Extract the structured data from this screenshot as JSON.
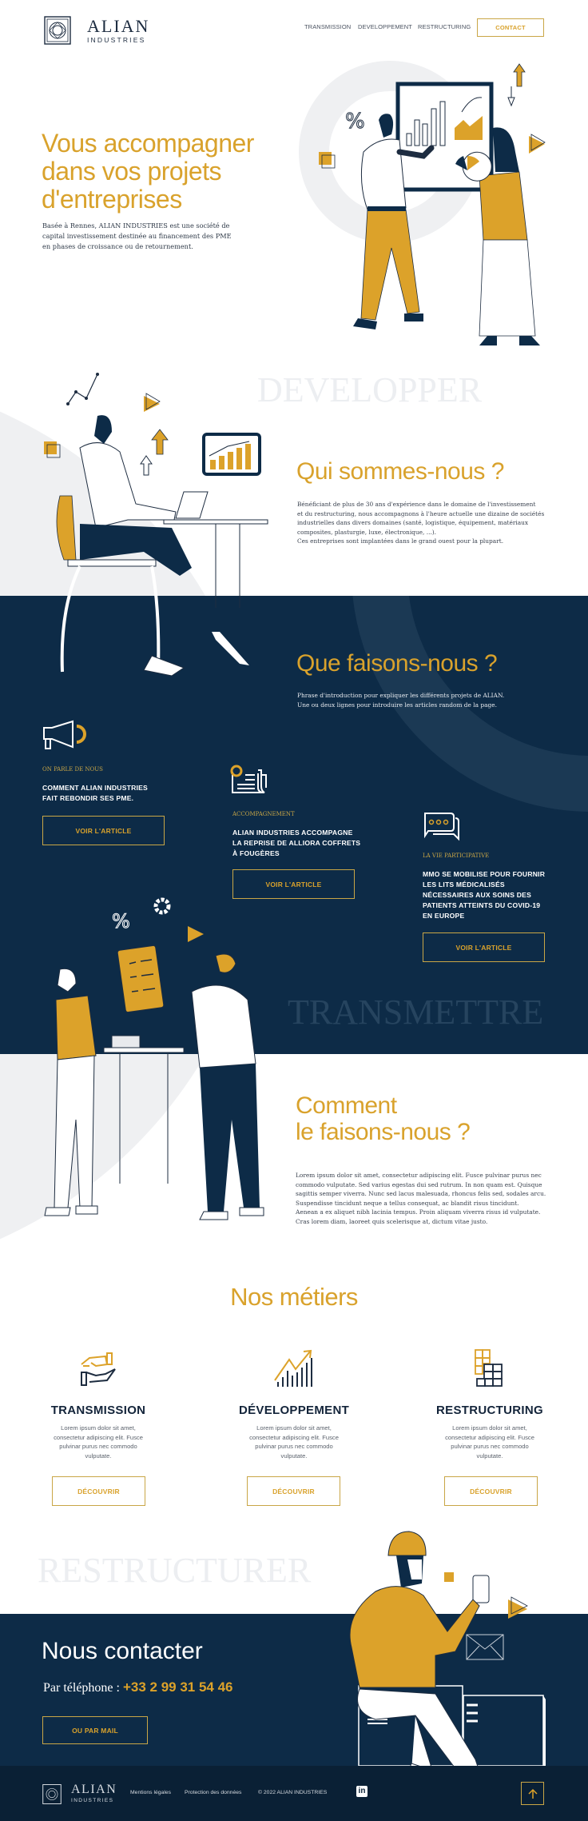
{
  "header": {
    "logo": {
      "name": "ALIAN",
      "sub": "INDUSTRIES"
    },
    "nav": [
      {
        "label": "TRANSMISSION"
      },
      {
        "label": "DEVELOPPEMENT"
      },
      {
        "label": "RESTRUCTURING"
      }
    ],
    "contact_label": "CONTACT"
  },
  "hero": {
    "title_lines": [
      "Vous accompagner",
      "dans vos projets",
      "d'entreprises"
    ],
    "text_lines": [
      "Basée à Rennes, ALIAN INDUSTRIES est une société de",
      "capital investissement destinée au financement des PME",
      "en phases de croissance ou de retournement."
    ]
  },
  "watermarks": {
    "develop": "DEVELOPPER",
    "transmit": "TRANSMETTRE",
    "restructure": "RESTRUCTURER"
  },
  "about": {
    "title": "Qui sommes-nous ?",
    "text_lines": [
      "Bénéficiant de plus de 30 ans d'expérience dans le domaine de l'investissement",
      "et du restructuring, nous accompagnons à l'heure actuelle une dizaine de sociétés",
      "industrielles dans divers domaines (santé, logistique, équipement, matériaux",
      "composites, plasturgie, luxe, électronique, ...).",
      "Ces entreprises sont implantées dans le grand ouest pour la plupart."
    ]
  },
  "what": {
    "title": "Que faisons-nous ?",
    "intro_lines": [
      "Phrase d'introduction pour expliquer les différents projets de ALIAN.",
      "Une ou deux lignes pour introduire les articles random de la page."
    ],
    "articles": [
      {
        "category": "ON PARLE DE NOUS",
        "title_lines": [
          "COMMENT ALIAN INDUSTRIES",
          "FAIT REBONDIR SES PME."
        ],
        "button": "VOIR L'ARTICLE",
        "icon": "megaphone-icon"
      },
      {
        "category": "ACCOMPAGNEMENT",
        "title_lines": [
          "ALIAN INDUSTRIES ACCOMPAGNE",
          "LA REPRISE DE ALLIORA COFFRETS",
          "À FOUGÈRES"
        ],
        "button": "VOIR L'ARTICLE",
        "icon": "newspaper-icon"
      },
      {
        "category": "LA VIE PARTICIPATIVE",
        "title_lines": [
          "MMO SE MOBILISE POUR FOURNIR",
          "LES LITS MÉDICALISÉS",
          "NÉCESSAIRES AUX SOINS DES",
          "PATIENTS ATTEINTS DU COVID-19",
          "EN EUROPE"
        ],
        "button": "VOIR L'ARTICLE",
        "icon": "chat-bubbles-icon"
      }
    ]
  },
  "how": {
    "title_lines": [
      "Comment",
      "le faisons-nous ?"
    ],
    "text_lines": [
      "Lorem ipsum dolor sit amet, consectetur adipiscing elit. Fusce pulvinar purus nec",
      "commodo vulputate. Sed varius egestas dui sed rutrum. In non quam est. Quisque",
      "sagittis semper viverra. Nunc sed lacus malesuada, rhoncus felis sed, sodales arcu.",
      "Suspendisse tincidunt neque a tellus consequat, ac blandit risus tincidunt.",
      "Aenean a ex aliquet nibh lacinia tempus. Proin aliquam viverra risus id vulputate.",
      "Cras lorem diam, laoreet quis scelerisque at, dictum vitae justo."
    ]
  },
  "metiers": {
    "title": "Nos métiers",
    "items": [
      {
        "title": "TRANSMISSION",
        "desc_lines": [
          "Lorem ipsum dolor sit amet,",
          "consectetur adipiscing elit. Fusce",
          "pulvinar purus nec commodo",
          "vulputate."
        ],
        "button": "DÉCOUVRIR"
      },
      {
        "title": "DÉVELOPPEMENT",
        "desc_lines": [
          "Lorem ipsum dolor sit amet,",
          "consectetur adipiscing elit. Fusce",
          "pulvinar purus nec commodo",
          "vulputate."
        ],
        "button": "DÉCOUVRIR"
      },
      {
        "title": "RESTRUCTURING",
        "desc_lines": [
          "Lorem ipsum dolor sit amet,",
          "consectetur adipiscing elit. Fusce",
          "pulvinar purus nec commodo",
          "vulputate."
        ],
        "button": "DÉCOUVRIR"
      }
    ]
  },
  "contact": {
    "title": "Nous contacter",
    "phone_label": "Par téléphone : ",
    "phone": "+33 2 99 31 54 46",
    "button": "OU PAR  MAIL"
  },
  "footer": {
    "logo": {
      "name": "ALIAN",
      "sub": "INDUSTRIES"
    },
    "links": [
      "Mentions légales",
      "Protection des données"
    ],
    "copyright": "© 2022  ALIAN INDUSTRIES"
  },
  "colors": {
    "gold": "#d9a22c",
    "navy": "#0d2b47",
    "footer": "#0a2035"
  }
}
